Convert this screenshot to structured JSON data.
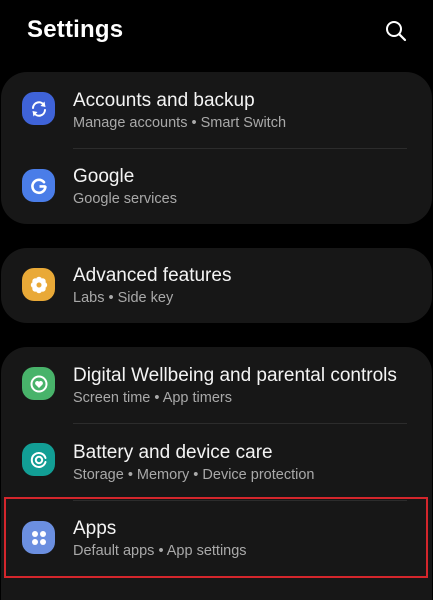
{
  "header": {
    "title": "Settings",
    "search_icon": "search-icon"
  },
  "groups": [
    {
      "items": [
        {
          "title": "Accounts and backup",
          "subtitle": "Manage accounts  •  Smart Switch",
          "icon": "sync-icon",
          "icon_color": "#3f63d8"
        },
        {
          "title": "Google",
          "subtitle": "Google services",
          "icon": "google-g-icon",
          "icon_color": "#4a7de8"
        }
      ]
    },
    {
      "items": [
        {
          "title": "Advanced features",
          "subtitle": "Labs  •  Side key",
          "icon": "flower-gear-icon",
          "icon_color": "#e9a937"
        }
      ]
    },
    {
      "items": [
        {
          "title": "Digital Wellbeing and parental controls",
          "subtitle": "Screen time  •  App timers",
          "icon": "heart-circle-icon",
          "icon_color": "#48b36a"
        },
        {
          "title": "Battery and device care",
          "subtitle": "Storage  •  Memory  •  Device protection",
          "icon": "device-care-icon",
          "icon_color": "#129e95"
        },
        {
          "title": "Apps",
          "subtitle": "Default apps  •  App settings",
          "icon": "apps-grid-icon",
          "icon_color": "#6b8fe0"
        }
      ]
    }
  ],
  "highlight_color": "#d4262c"
}
